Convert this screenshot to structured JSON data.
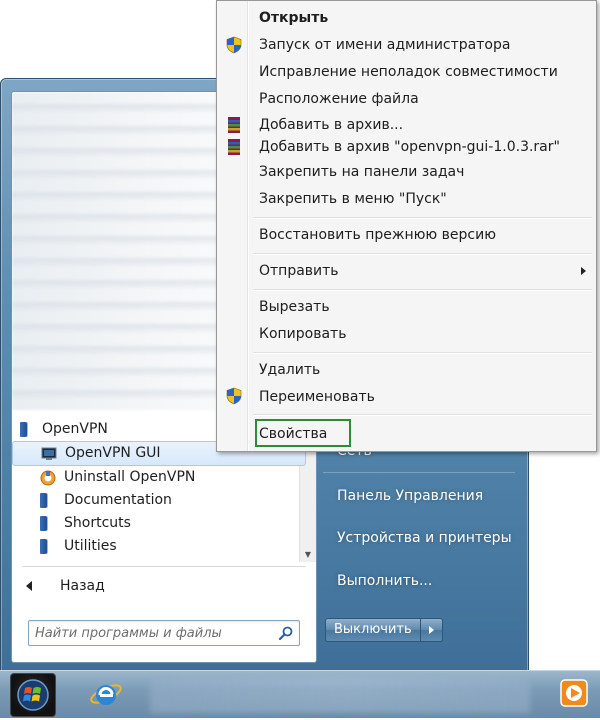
{
  "context_menu": {
    "items": [
      {
        "label": "Открыть",
        "bold": true
      },
      {
        "label": "Запуск от имени администратора",
        "icon": "uac-shield-icon"
      },
      {
        "label": "Исправление неполадок совместимости"
      },
      {
        "label": "Расположение файла"
      },
      {
        "label": "Добавить в архив...",
        "icon": "winrar-icon"
      },
      {
        "label": "Добавить в архив \"openvpn-gui-1.0.3.rar\"",
        "icon": "winrar-icon"
      },
      {
        "label": "Закрепить на панели задач"
      },
      {
        "label": "Закрепить в меню \"Пуск\""
      },
      {
        "label": "Восстановить прежнюю версию"
      },
      {
        "label": "Отправить",
        "submenu": true
      },
      {
        "label": "Вырезать"
      },
      {
        "label": "Копировать"
      },
      {
        "label": "Удалить"
      },
      {
        "label": "Переименовать",
        "icon": "uac-shield-icon"
      },
      {
        "label": "Свойства",
        "highlighted_box_color": "#2e8b3a"
      }
    ]
  },
  "start_menu": {
    "programs": [
      {
        "label": "OpenVPN",
        "type": "folder"
      },
      {
        "label": "OpenVPN GUI",
        "type": "app",
        "selected": true
      },
      {
        "label": "Uninstall OpenVPN",
        "type": "app"
      },
      {
        "label": "Documentation",
        "type": "folder"
      },
      {
        "label": "Shortcuts",
        "type": "folder"
      },
      {
        "label": "Utilities",
        "type": "folder"
      }
    ],
    "back_label": "Назад",
    "search_placeholder": "Найти программы и файлы",
    "right_items": {
      "partial": "Сеть",
      "control_panel": "Панель  Управления",
      "devices": "Устройства и принтеры",
      "run": "Выполнить..."
    },
    "shutdown_label": "Выключить"
  },
  "colors": {
    "highlight_box": "#2e8b3a",
    "menu_bg": "#f5f5f5",
    "start_menu_blue": "#5f8fb3"
  }
}
